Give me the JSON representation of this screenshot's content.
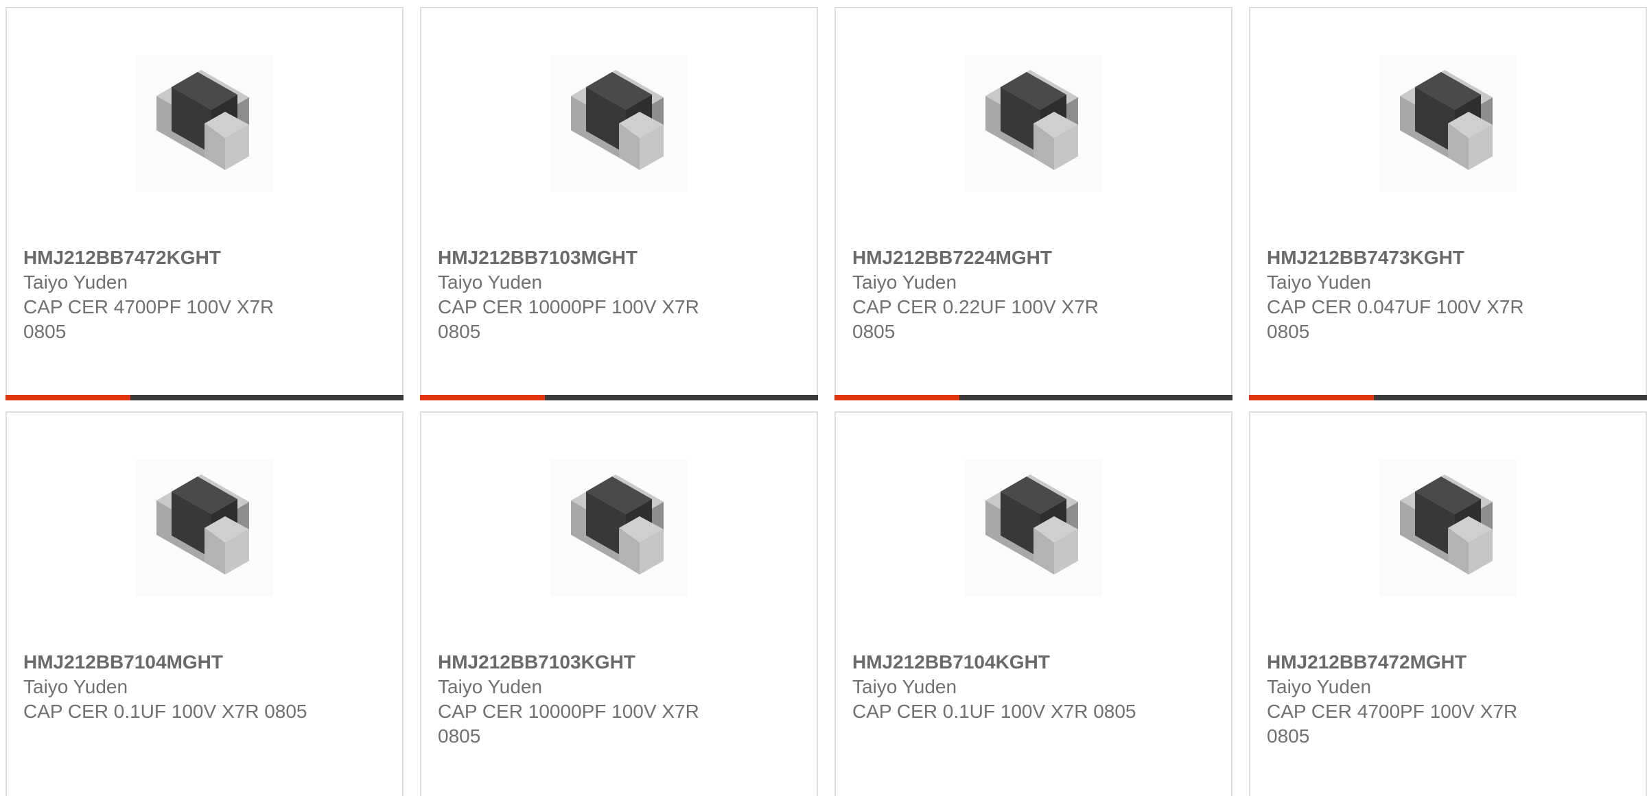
{
  "colors": {
    "accent": "#e3360f",
    "bar_dark": "#3b3b3b",
    "border": "#dcdcdc",
    "text": "#707070"
  },
  "products": [
    {
      "part_number": "HMJ212BB7472KGHT",
      "manufacturer": "Taiyo Yuden",
      "description": "CAP CER 4700PF 100V X7R 0805",
      "image_icon": "ceramic-capacitor-image"
    },
    {
      "part_number": "HMJ212BB7103MGHT",
      "manufacturer": "Taiyo Yuden",
      "description": "CAP CER 10000PF 100V X7R 0805",
      "image_icon": "ceramic-capacitor-image"
    },
    {
      "part_number": "HMJ212BB7224MGHT",
      "manufacturer": "Taiyo Yuden",
      "description": "CAP CER 0.22UF 100V X7R 0805",
      "image_icon": "ceramic-capacitor-image"
    },
    {
      "part_number": "HMJ212BB7473KGHT",
      "manufacturer": "Taiyo Yuden",
      "description": "CAP CER 0.047UF 100V X7R 0805",
      "image_icon": "ceramic-capacitor-image"
    },
    {
      "part_number": "HMJ212BB7104MGHT",
      "manufacturer": "Taiyo Yuden",
      "description": "CAP CER 0.1UF 100V X7R 0805",
      "image_icon": "ceramic-capacitor-image"
    },
    {
      "part_number": "HMJ212BB7103KGHT",
      "manufacturer": "Taiyo Yuden",
      "description": "CAP CER 10000PF 100V X7R 0805",
      "image_icon": "ceramic-capacitor-image"
    },
    {
      "part_number": "HMJ212BB7104KGHT",
      "manufacturer": "Taiyo Yuden",
      "description": "CAP CER 0.1UF 100V X7R 0805",
      "image_icon": "ceramic-capacitor-image"
    },
    {
      "part_number": "HMJ212BB7472MGHT",
      "manufacturer": "Taiyo Yuden",
      "description": "CAP CER 4700PF 100V X7R 0805",
      "image_icon": "ceramic-capacitor-image"
    }
  ]
}
